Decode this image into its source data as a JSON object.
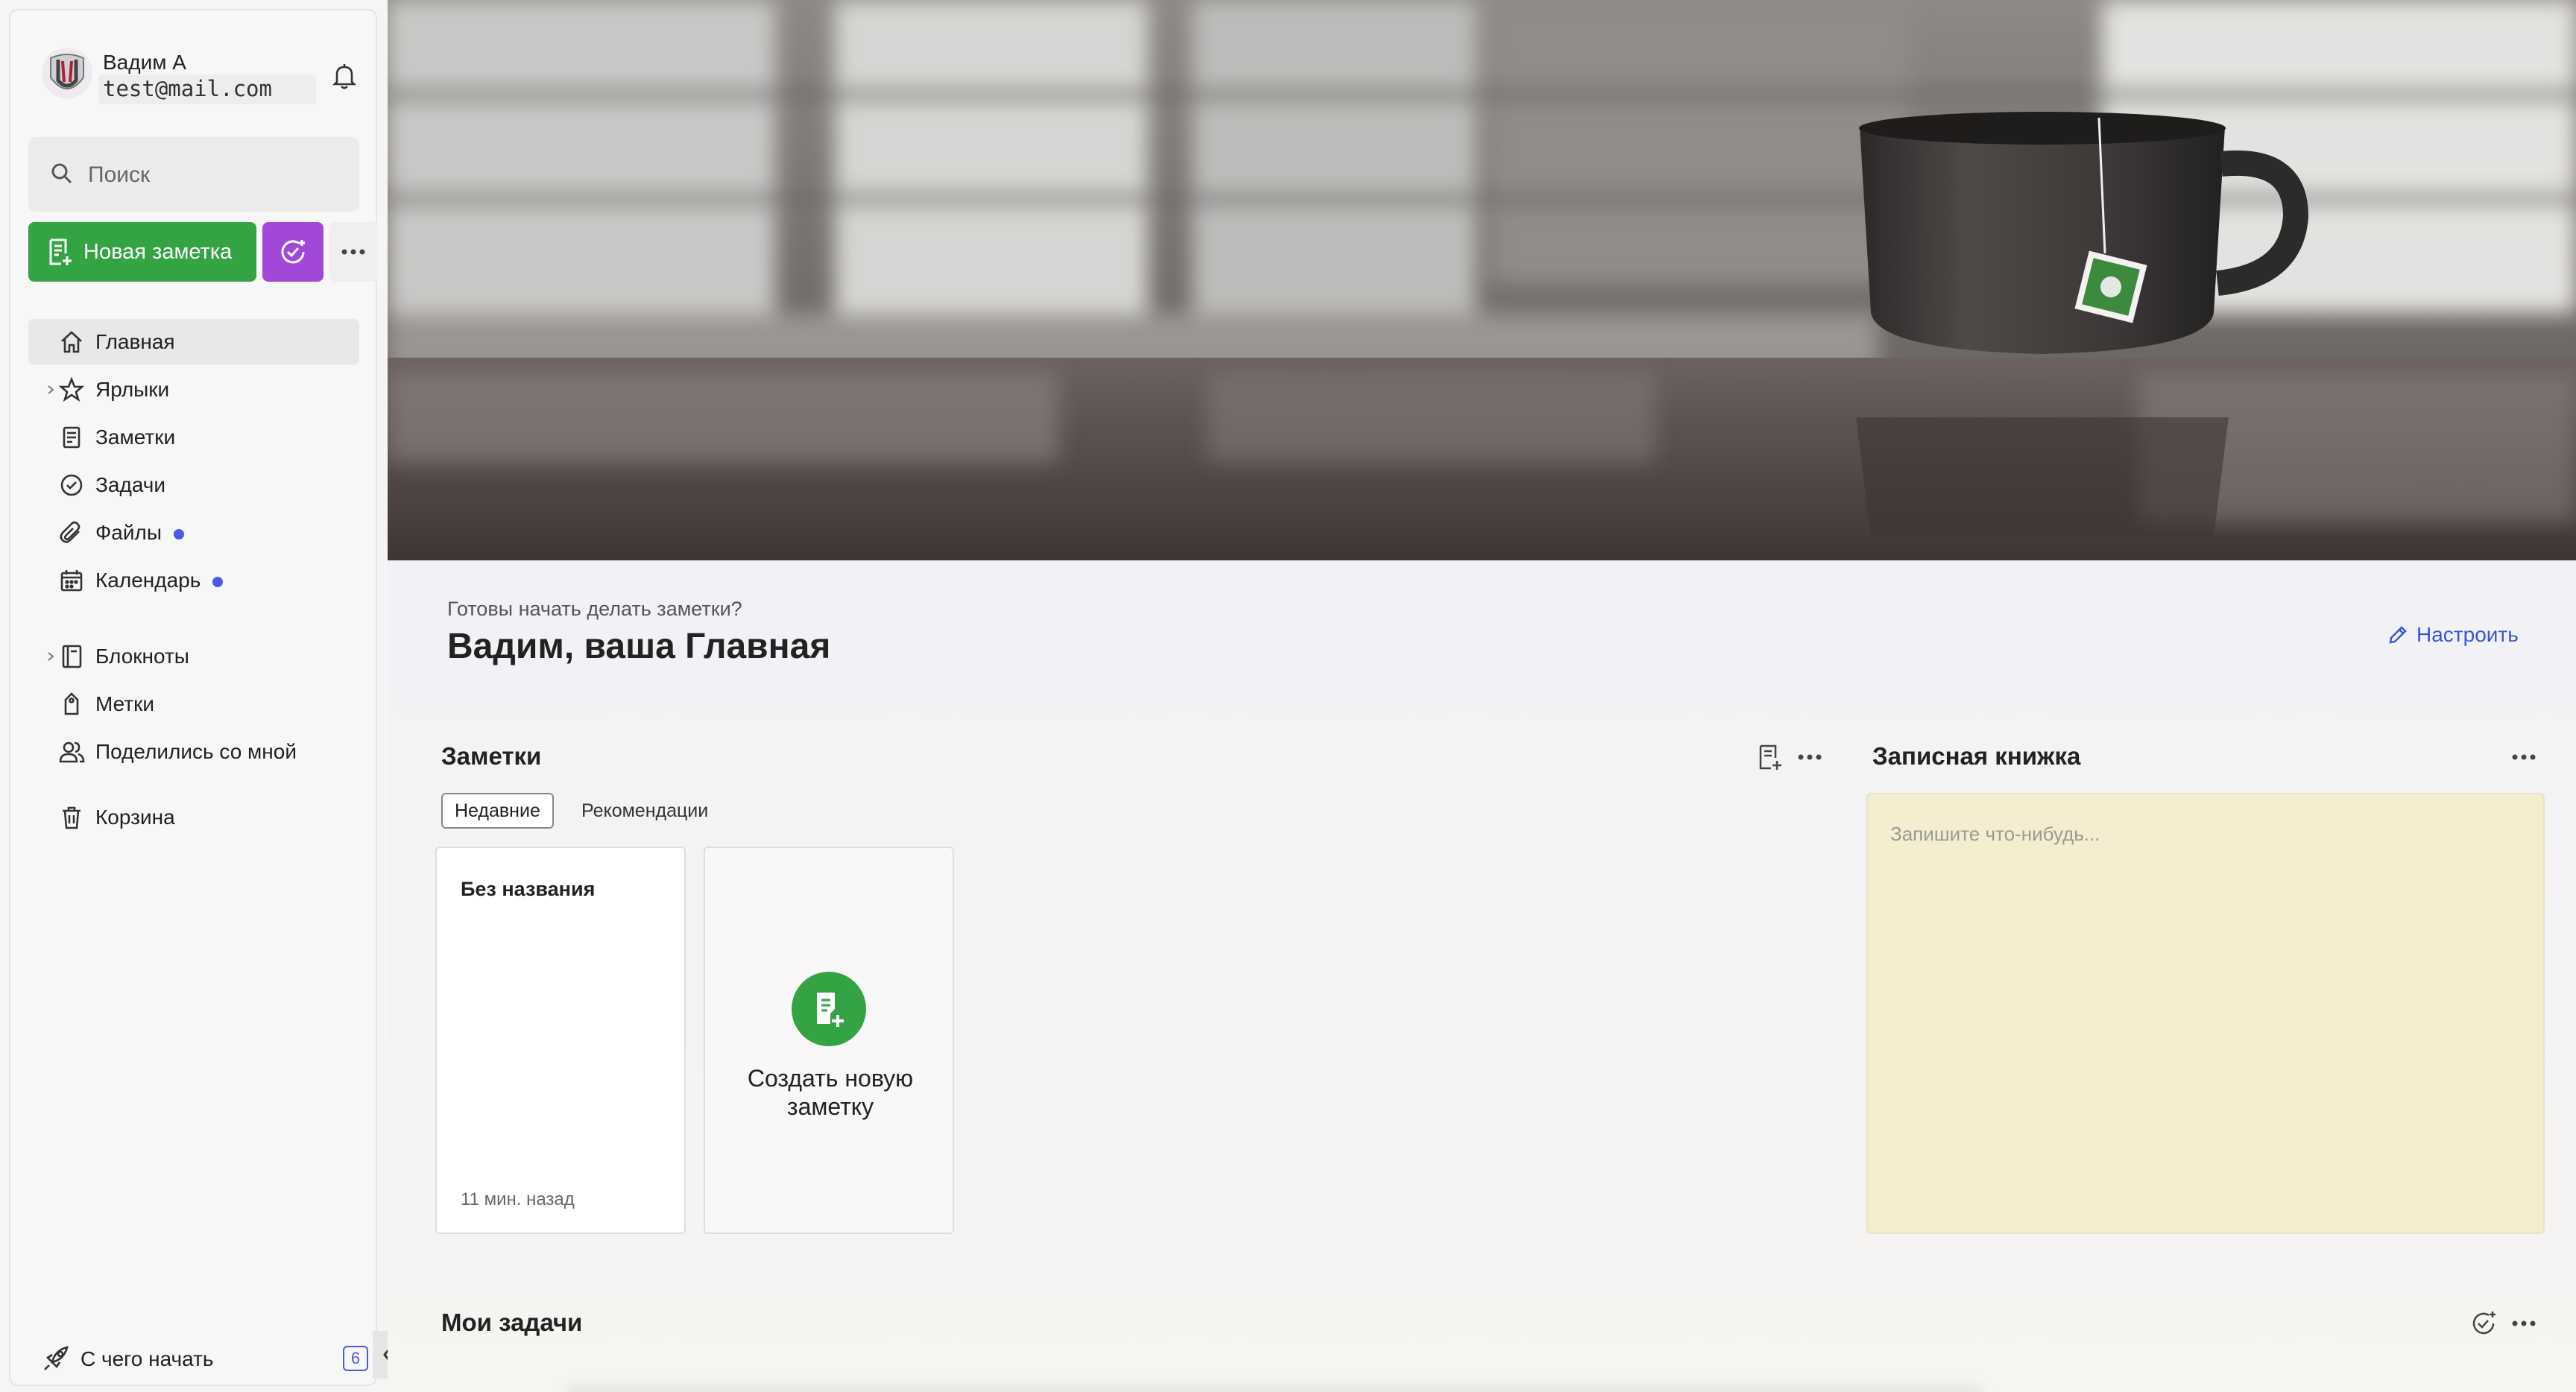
{
  "user": {
    "name": "Вадим А",
    "email": "test@mail.com"
  },
  "sidebar": {
    "search_placeholder": "Поиск",
    "new_note_label": "Новая заметка",
    "items": [
      {
        "label": "Главная",
        "icon": "home-icon",
        "active": true
      },
      {
        "label": "Ярлыки",
        "icon": "star-icon",
        "expandable": true
      },
      {
        "label": "Заметки",
        "icon": "note-icon"
      },
      {
        "label": "Задачи",
        "icon": "task-check-icon"
      },
      {
        "label": "Файлы",
        "icon": "paperclip-icon",
        "dot": true
      },
      {
        "label": "Календарь",
        "icon": "calendar-icon",
        "dot": true
      },
      {
        "label": "Блокноты",
        "icon": "notebook-icon",
        "expandable": true
      },
      {
        "label": "Метки",
        "icon": "tag-icon"
      },
      {
        "label": "Поделились со мной",
        "icon": "people-icon"
      },
      {
        "label": "Корзина",
        "icon": "trash-icon"
      }
    ],
    "getting_started_label": "С чего начать",
    "getting_started_count": "6",
    "dot_color": "#4a5ae8"
  },
  "main": {
    "subtitle": "Готовы начать делать заметки?",
    "title": "Вадим, ваша Главная",
    "customize_label": "Настроить",
    "notes": {
      "title": "Заметки",
      "tabs": [
        "Недавние",
        "Рекомендации"
      ],
      "cards": [
        {
          "title": "Без названия",
          "time": "11 мин. назад"
        }
      ],
      "create_label": "Создать новую заметку"
    },
    "scratchpad": {
      "title": "Записная книжка",
      "placeholder": "Запишите что-нибудь..."
    },
    "tasks": {
      "title": "Мои задачи"
    }
  },
  "colors": {
    "brand_green": "#33a344",
    "task_purple": "#a148d8",
    "link_blue": "#3a56d8",
    "scratchpad_bg": "#f5edcf"
  }
}
